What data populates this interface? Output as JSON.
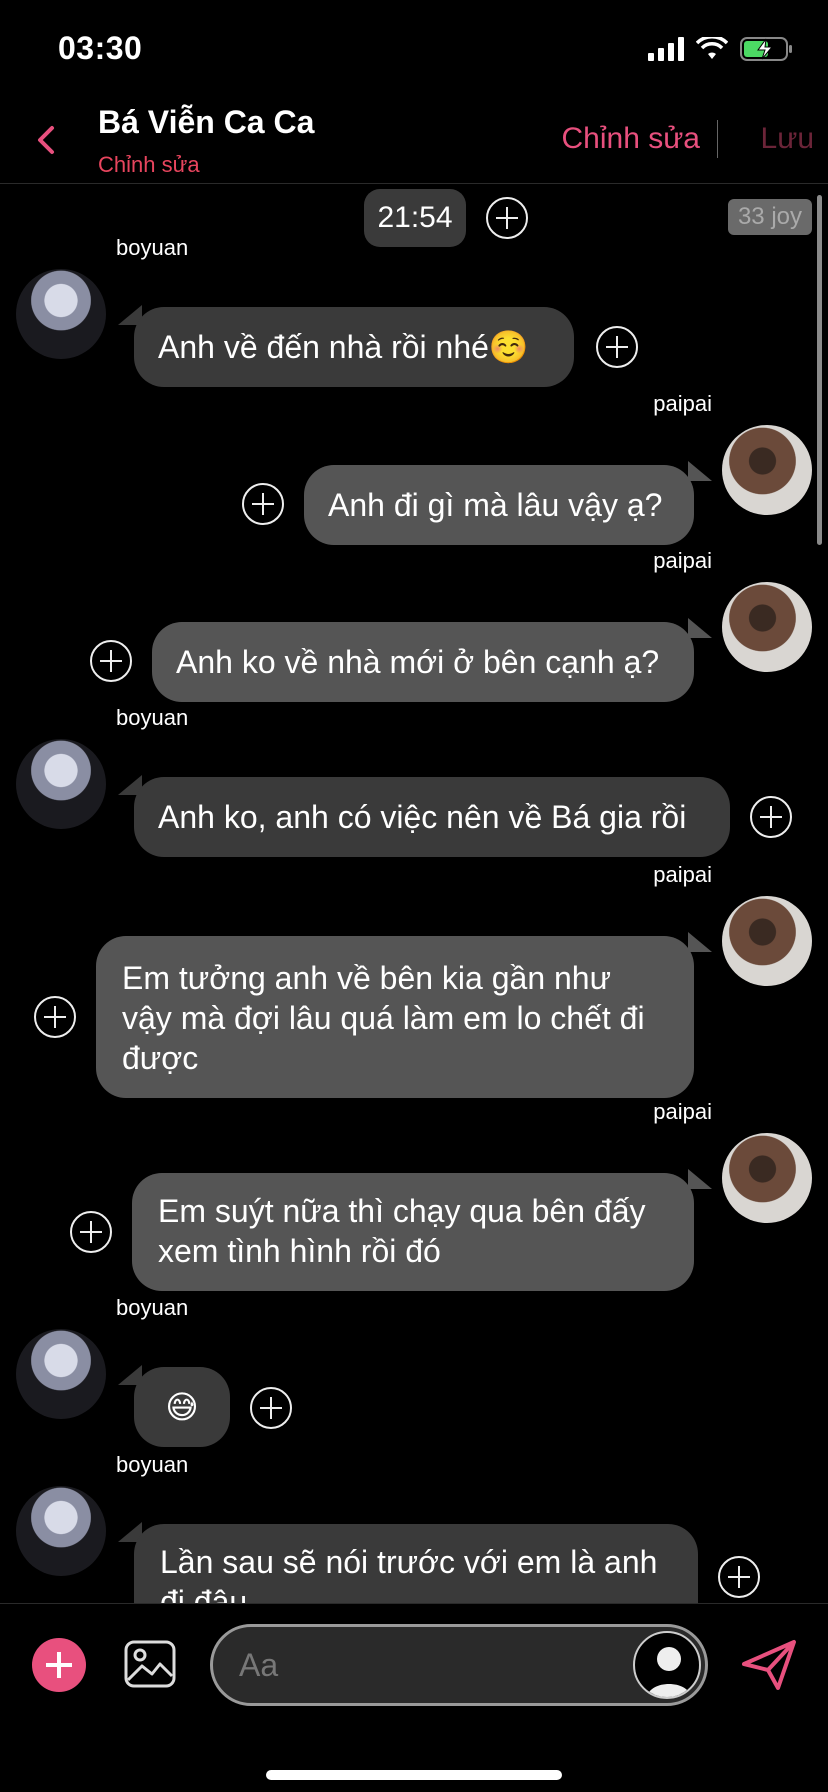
{
  "status": {
    "time": "03:30"
  },
  "header": {
    "contact_name": "Bá Viễn Ca Ca",
    "subtitle": "Chỉnh sửa",
    "edit_label": "Chỉnh sửa",
    "save_label": "Lưu"
  },
  "chat": {
    "time_marker": "21:54",
    "badge": "33 joy",
    "messages": [
      {
        "sender": "boyuan",
        "side": "left",
        "text": "Anh về đến nhà rồi nhé☺️"
      },
      {
        "sender": "paipai",
        "side": "right",
        "text": "Anh đi gì mà lâu vậy ạ?"
      },
      {
        "sender": "paipai",
        "side": "right",
        "text": "Anh ko về nhà mới ở bên cạnh ạ?"
      },
      {
        "sender": "boyuan",
        "side": "left",
        "text": "Anh ko, anh có việc nên về Bá gia rồi"
      },
      {
        "sender": "paipai",
        "side": "right",
        "text": "Em tưởng anh về bên kia gần như vậy mà đợi lâu quá làm em lo chết đi được"
      },
      {
        "sender": "paipai",
        "side": "right",
        "text": "Em suýt nữa thì chạy qua bên đấy xem tình hình rồi đó"
      },
      {
        "sender": "boyuan",
        "side": "left",
        "text": "😅"
      },
      {
        "sender": "boyuan",
        "side": "left",
        "text": "Lần sau sẽ nói trước với em là anh đi đâu"
      }
    ]
  },
  "composer": {
    "placeholder": "Aa"
  },
  "colors": {
    "accent": "#e8507e",
    "bubble_left": "#3a3a3a",
    "bubble_right": "#555555"
  }
}
